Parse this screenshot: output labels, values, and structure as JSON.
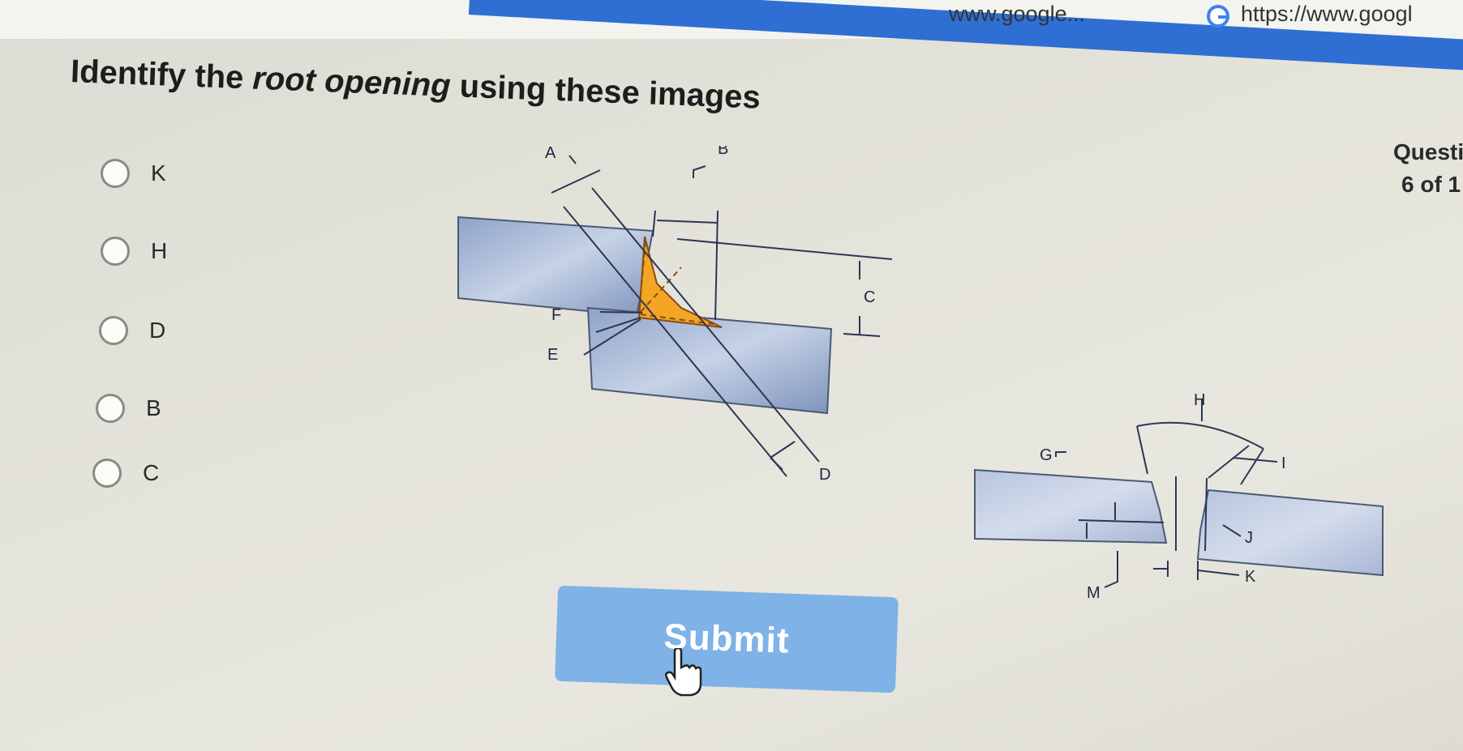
{
  "browser": {
    "tab1_text": "www.google...",
    "tab2_text": "https://www.googl"
  },
  "question": {
    "prefix": "Identify the ",
    "emphasis": "root opening",
    "suffix": " using these images"
  },
  "progress": {
    "label": "Questi",
    "count": "6 of 1"
  },
  "options": [
    {
      "label": "K"
    },
    {
      "label": "H"
    },
    {
      "label": "D"
    },
    {
      "label": "B"
    },
    {
      "label": "C"
    }
  ],
  "diagram1_labels": {
    "a": "A",
    "b": "B",
    "c": "C",
    "d": "D",
    "e": "E",
    "f": "F"
  },
  "diagram2_labels": {
    "g": "G",
    "h": "H",
    "i": "I",
    "j": "J",
    "k": "K",
    "m": "M"
  },
  "submit": {
    "label": "Submit"
  }
}
